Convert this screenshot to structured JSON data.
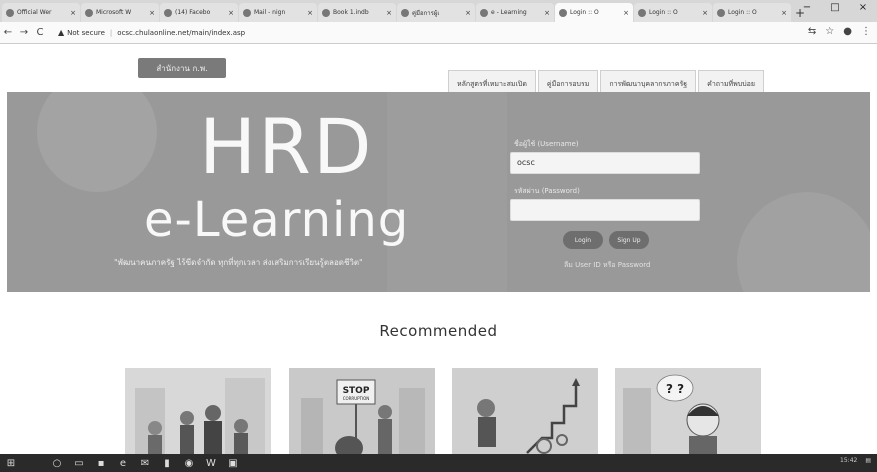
{
  "browser": {
    "tabs": [
      {
        "label": "Official Wer",
        "active": false
      },
      {
        "label": "Microsoft W",
        "active": false
      },
      {
        "label": "(14) Facebo",
        "active": false
      },
      {
        "label": "Mail - nign",
        "active": false
      },
      {
        "label": "Book 1.indb",
        "active": false
      },
      {
        "label": "คู่มือการผู้เ",
        "active": false
      },
      {
        "label": "e - Learning",
        "active": false
      },
      {
        "label": "Login :: O",
        "active": true
      },
      {
        "label": "Login :: O",
        "active": false
      },
      {
        "label": "Login :: O",
        "active": false
      }
    ],
    "tab_close": "×",
    "new_tab": "+",
    "window_controls": [
      "−",
      "□",
      "×"
    ],
    "not_secure": "Not secure",
    "url": "ocsc.chulaonline.net/main/index.asp"
  },
  "site": {
    "logo_text": "สำนักงาน ก.พ.",
    "nav": [
      "หลักสูตรที่เหมาะสมเปิด",
      "คู่มือการอบรม",
      "การพัฒนาบุคลากรภาครัฐ",
      "คำถามที่พบบ่อย"
    ],
    "hero": {
      "title": "HRD",
      "subtitle": "e-Learning",
      "tagline": "\"พัฒนาคนภาครัฐ ไร้ขีดจำกัด ทุกที่ทุกเวลา ส่งเสริมการเรียนรู้ตลอดชีวิต\""
    },
    "login": {
      "user_label": "ชื่อผู้ใช้ (Username)",
      "user_value": "ocsc",
      "pass_label": "รหัสผ่าน (Password)",
      "pass_value": "",
      "login_button": "Login",
      "signup_button": "Sign Up",
      "forgot": "ลืม User ID หรือ Password"
    },
    "recommended_title": "Recommended",
    "cards": [
      {
        "name": "card-people"
      },
      {
        "name": "card-stop-corruption",
        "sign": "STOP",
        "sign_sub": "CORRUPTION"
      },
      {
        "name": "card-growth"
      },
      {
        "name": "card-question",
        "marks": "? ?"
      }
    ]
  },
  "taskbar": {
    "clock": "15:42"
  }
}
